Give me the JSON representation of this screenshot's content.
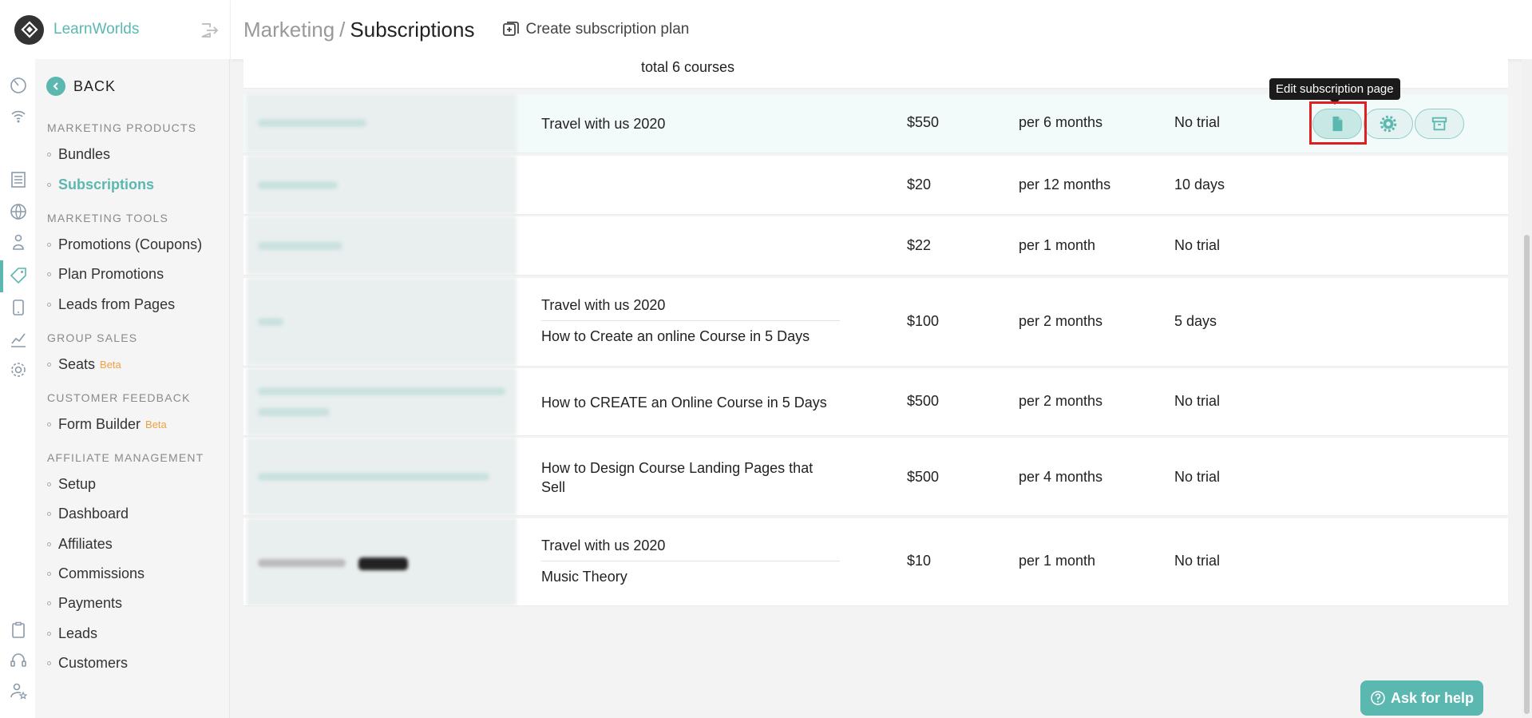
{
  "brand": {
    "name": "LearnWorlds"
  },
  "sidebar": {
    "back_label": "BACK",
    "sections": [
      {
        "title": "MARKETING PRODUCTS",
        "items": [
          {
            "label": "Bundles"
          },
          {
            "label": "Subscriptions",
            "active": true
          }
        ]
      },
      {
        "title": "MARKETING TOOLS",
        "items": [
          {
            "label": "Promotions (Coupons)"
          },
          {
            "label": "Plan Promotions"
          },
          {
            "label": "Leads from Pages"
          }
        ]
      },
      {
        "title": "GROUP SALES",
        "items": [
          {
            "label": "Seats",
            "badge": "Beta"
          }
        ]
      },
      {
        "title": "CUSTOMER FEEDBACK",
        "items": [
          {
            "label": "Form Builder",
            "badge": "Beta"
          }
        ]
      },
      {
        "title": "AFFILIATE MANAGEMENT",
        "items": [
          {
            "label": "Setup"
          },
          {
            "label": "Dashboard"
          },
          {
            "label": "Affiliates"
          },
          {
            "label": "Commissions"
          },
          {
            "label": "Payments"
          },
          {
            "label": "Leads"
          },
          {
            "label": "Customers"
          }
        ]
      }
    ]
  },
  "header": {
    "crumb_parent": "Marketing",
    "crumb_separator": "/",
    "crumb_current": "Subscriptions",
    "create_label": "Create subscription plan"
  },
  "table": {
    "partial_row_text": "total 6 courses",
    "rows": [
      {
        "courses": [
          "Travel with us 2020"
        ],
        "price": "$550",
        "period": "per 6 months",
        "trial": "No trial"
      },
      {
        "courses": [],
        "price": "$20",
        "period": "per 12 months",
        "trial": "10 days"
      },
      {
        "courses": [],
        "price": "$22",
        "period": "per 1 month",
        "trial": "No trial"
      },
      {
        "courses": [
          "Travel with us 2020",
          "How to Create an online Course in 5 Days"
        ],
        "price": "$100",
        "period": "per 2 months",
        "trial": "5 days"
      },
      {
        "courses": [
          "How to CREATE an Online Course in 5 Days"
        ],
        "price": "$500",
        "period": "per 2 months",
        "trial": "No trial"
      },
      {
        "courses": [
          "How to Design Course Landing Pages that Sell"
        ],
        "price": "$500",
        "period": "per 4 months",
        "trial": "No trial"
      },
      {
        "courses": [
          "Travel with us 2020",
          "Music Theory"
        ],
        "price": "$10",
        "period": "per 1 month",
        "trial": "No trial"
      }
    ]
  },
  "tooltip": {
    "text": "Edit subscription page"
  },
  "help": {
    "label": "Ask for help"
  },
  "colors": {
    "accent": "#5bb8b0",
    "beta": "#f0a040",
    "highlight": "#e02020"
  }
}
